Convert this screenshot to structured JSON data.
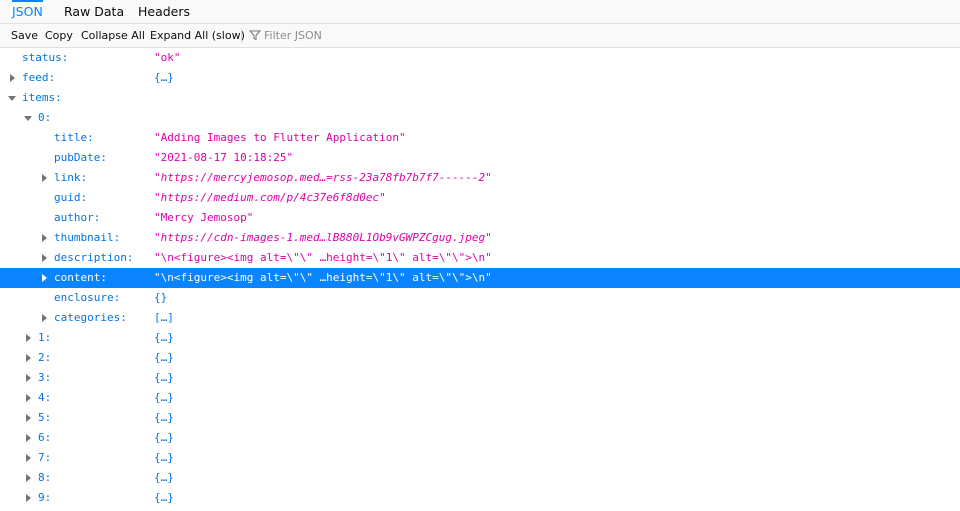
{
  "tabs": [
    {
      "label": "JSON"
    },
    {
      "label": "Raw Data"
    },
    {
      "label": "Headers"
    }
  ],
  "toolbar": {
    "save": "Save",
    "copy": "Copy",
    "collapse_all": "Collapse All",
    "expand_all": "Expand All (slow)",
    "filter_placeholder": "Filter JSON"
  },
  "tree": {
    "status": {
      "key": "status:",
      "value": "\"ok\""
    },
    "feed": {
      "key": "feed:",
      "value": "{…}"
    },
    "items": {
      "key": "items:"
    },
    "item0": {
      "key": "0:"
    },
    "title": {
      "key": "title:",
      "value": "\"Adding Images to Flutter Application\""
    },
    "pubDate": {
      "key": "pubDate:",
      "value": "\"2021-08-17 10:18:25\""
    },
    "link": {
      "key": "link:",
      "value": "\"https://mercyjemosop.med…=rss-23a78fb7b7f7------2\""
    },
    "guid": {
      "key": "guid:",
      "value": "\"https://medium.com/p/4c37e6f8d0ec\""
    },
    "author": {
      "key": "author:",
      "value": "\"Mercy Jemosop\""
    },
    "thumbnail": {
      "key": "thumbnail:",
      "value": "\"https://cdn-images-1.med…lB880L1Ob9vGWPZCgug.jpeg\""
    },
    "description": {
      "key": "description:",
      "value": "\"\\n<figure><img alt=\\\"\\\" …height=\\\"1\\\" alt=\\\"\\\">\\n\""
    },
    "content": {
      "key": "content:",
      "value": "\"\\n<figure><img alt=\\\"\\\" …height=\\\"1\\\" alt=\\\"\\\">\\n\""
    },
    "enclosure": {
      "key": "enclosure:",
      "value": "{}"
    },
    "categories": {
      "key": "categories:",
      "value": "[…]"
    },
    "others": [
      {
        "key": "1:",
        "value": "{…}"
      },
      {
        "key": "2:",
        "value": "{…}"
      },
      {
        "key": "3:",
        "value": "{…}"
      },
      {
        "key": "4:",
        "value": "{…}"
      },
      {
        "key": "5:",
        "value": "{…}"
      },
      {
        "key": "6:",
        "value": "{…}"
      },
      {
        "key": "7:",
        "value": "{…}"
      },
      {
        "key": "8:",
        "value": "{…}"
      },
      {
        "key": "9:",
        "value": "{…}"
      }
    ]
  },
  "colors": {
    "accent": "#0a84ff",
    "key": "#0074e8",
    "string": "#dd00a9"
  }
}
